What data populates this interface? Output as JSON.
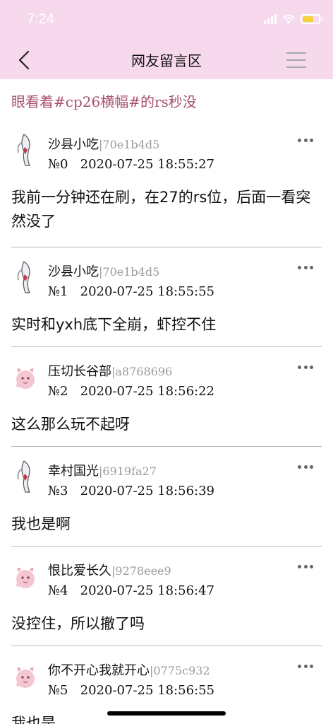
{
  "status": {
    "time": "7:24"
  },
  "nav": {
    "title": "网友留言区"
  },
  "topic": "眼看着#cp26横幅#的rs秒没",
  "posts": [
    {
      "name": "沙县小吃",
      "uid": "|70e1b4d5",
      "meta": "№0   2020-07-25 18:55:27",
      "content": "我前一分钟还在刷，在27的rs位，后面一看突然没了",
      "avatar": "sword-avatar"
    },
    {
      "name": "沙县小吃",
      "uid": "|70e1b4d5",
      "meta": "№1   2020-07-25 18:55:55",
      "content": "实时和yxh底下全崩，虾控不住",
      "avatar": "sword-avatar"
    },
    {
      "name": "压切长谷部",
      "uid": "|a8768696",
      "meta": "№2   2020-07-25 18:56:22",
      "content": "这么那么玩不起呀",
      "avatar": "pink-creature-avatar"
    },
    {
      "name": "幸村国光",
      "uid": "|6919fa27",
      "meta": "№3   2020-07-25 18:56:39",
      "content": "我也是啊",
      "avatar": "sword-avatar"
    },
    {
      "name": "恨比爱长久",
      "uid": "|9278eee9",
      "meta": "№4   2020-07-25 18:56:47",
      "content": "没控住，所以撤了吗",
      "avatar": "pink-creature-avatar"
    },
    {
      "name": "你不开心我就开心",
      "uid": "|0775c932",
      "meta": "№5   2020-07-25 18:56:55",
      "content": "我也是",
      "avatar": "pink-creature-avatar"
    }
  ],
  "colors": {
    "header_bg": "#f6d9ec",
    "topic": "#a7506f",
    "uid": "#9a9a9a"
  }
}
